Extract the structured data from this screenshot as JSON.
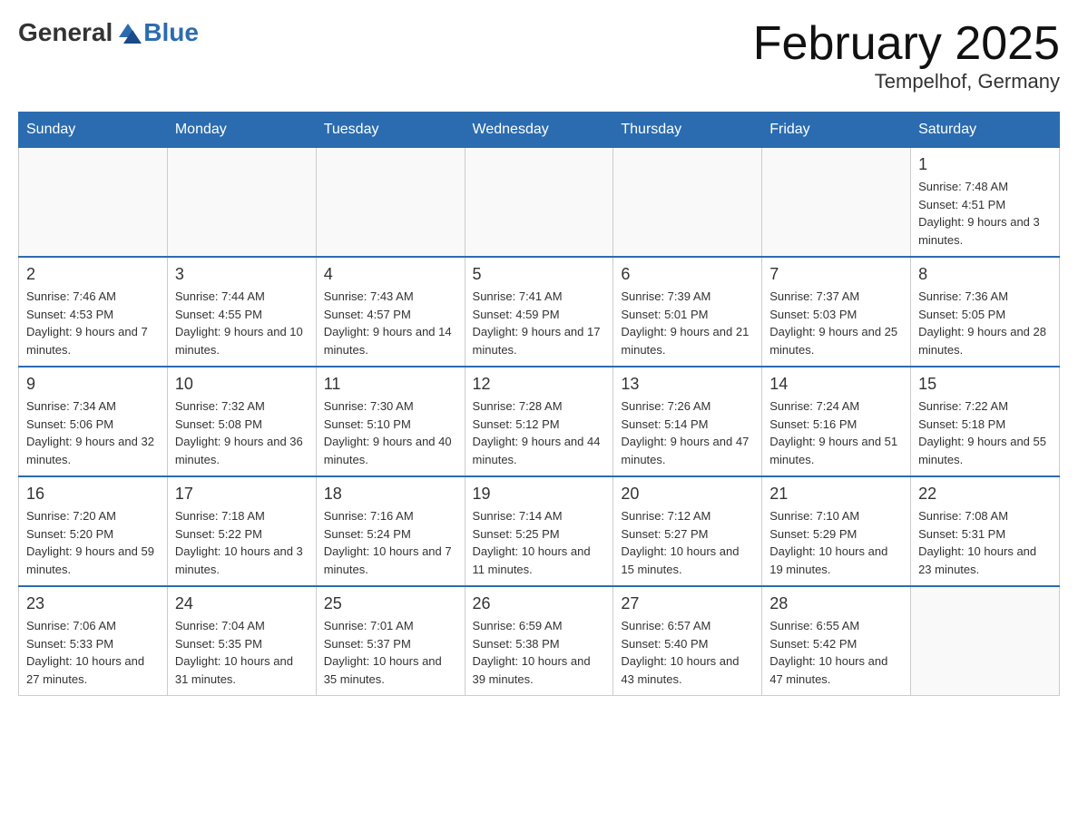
{
  "header": {
    "logo_general": "General",
    "logo_blue": "Blue",
    "title": "February 2025",
    "location": "Tempelhof, Germany"
  },
  "days_of_week": [
    "Sunday",
    "Monday",
    "Tuesday",
    "Wednesday",
    "Thursday",
    "Friday",
    "Saturday"
  ],
  "weeks": [
    [
      {
        "day": "",
        "info": ""
      },
      {
        "day": "",
        "info": ""
      },
      {
        "day": "",
        "info": ""
      },
      {
        "day": "",
        "info": ""
      },
      {
        "day": "",
        "info": ""
      },
      {
        "day": "",
        "info": ""
      },
      {
        "day": "1",
        "info": "Sunrise: 7:48 AM\nSunset: 4:51 PM\nDaylight: 9 hours and 3 minutes."
      }
    ],
    [
      {
        "day": "2",
        "info": "Sunrise: 7:46 AM\nSunset: 4:53 PM\nDaylight: 9 hours and 7 minutes."
      },
      {
        "day": "3",
        "info": "Sunrise: 7:44 AM\nSunset: 4:55 PM\nDaylight: 9 hours and 10 minutes."
      },
      {
        "day": "4",
        "info": "Sunrise: 7:43 AM\nSunset: 4:57 PM\nDaylight: 9 hours and 14 minutes."
      },
      {
        "day": "5",
        "info": "Sunrise: 7:41 AM\nSunset: 4:59 PM\nDaylight: 9 hours and 17 minutes."
      },
      {
        "day": "6",
        "info": "Sunrise: 7:39 AM\nSunset: 5:01 PM\nDaylight: 9 hours and 21 minutes."
      },
      {
        "day": "7",
        "info": "Sunrise: 7:37 AM\nSunset: 5:03 PM\nDaylight: 9 hours and 25 minutes."
      },
      {
        "day": "8",
        "info": "Sunrise: 7:36 AM\nSunset: 5:05 PM\nDaylight: 9 hours and 28 minutes."
      }
    ],
    [
      {
        "day": "9",
        "info": "Sunrise: 7:34 AM\nSunset: 5:06 PM\nDaylight: 9 hours and 32 minutes."
      },
      {
        "day": "10",
        "info": "Sunrise: 7:32 AM\nSunset: 5:08 PM\nDaylight: 9 hours and 36 minutes."
      },
      {
        "day": "11",
        "info": "Sunrise: 7:30 AM\nSunset: 5:10 PM\nDaylight: 9 hours and 40 minutes."
      },
      {
        "day": "12",
        "info": "Sunrise: 7:28 AM\nSunset: 5:12 PM\nDaylight: 9 hours and 44 minutes."
      },
      {
        "day": "13",
        "info": "Sunrise: 7:26 AM\nSunset: 5:14 PM\nDaylight: 9 hours and 47 minutes."
      },
      {
        "day": "14",
        "info": "Sunrise: 7:24 AM\nSunset: 5:16 PM\nDaylight: 9 hours and 51 minutes."
      },
      {
        "day": "15",
        "info": "Sunrise: 7:22 AM\nSunset: 5:18 PM\nDaylight: 9 hours and 55 minutes."
      }
    ],
    [
      {
        "day": "16",
        "info": "Sunrise: 7:20 AM\nSunset: 5:20 PM\nDaylight: 9 hours and 59 minutes."
      },
      {
        "day": "17",
        "info": "Sunrise: 7:18 AM\nSunset: 5:22 PM\nDaylight: 10 hours and 3 minutes."
      },
      {
        "day": "18",
        "info": "Sunrise: 7:16 AM\nSunset: 5:24 PM\nDaylight: 10 hours and 7 minutes."
      },
      {
        "day": "19",
        "info": "Sunrise: 7:14 AM\nSunset: 5:25 PM\nDaylight: 10 hours and 11 minutes."
      },
      {
        "day": "20",
        "info": "Sunrise: 7:12 AM\nSunset: 5:27 PM\nDaylight: 10 hours and 15 minutes."
      },
      {
        "day": "21",
        "info": "Sunrise: 7:10 AM\nSunset: 5:29 PM\nDaylight: 10 hours and 19 minutes."
      },
      {
        "day": "22",
        "info": "Sunrise: 7:08 AM\nSunset: 5:31 PM\nDaylight: 10 hours and 23 minutes."
      }
    ],
    [
      {
        "day": "23",
        "info": "Sunrise: 7:06 AM\nSunset: 5:33 PM\nDaylight: 10 hours and 27 minutes."
      },
      {
        "day": "24",
        "info": "Sunrise: 7:04 AM\nSunset: 5:35 PM\nDaylight: 10 hours and 31 minutes."
      },
      {
        "day": "25",
        "info": "Sunrise: 7:01 AM\nSunset: 5:37 PM\nDaylight: 10 hours and 35 minutes."
      },
      {
        "day": "26",
        "info": "Sunrise: 6:59 AM\nSunset: 5:38 PM\nDaylight: 10 hours and 39 minutes."
      },
      {
        "day": "27",
        "info": "Sunrise: 6:57 AM\nSunset: 5:40 PM\nDaylight: 10 hours and 43 minutes."
      },
      {
        "day": "28",
        "info": "Sunrise: 6:55 AM\nSunset: 5:42 PM\nDaylight: 10 hours and 47 minutes."
      },
      {
        "day": "",
        "info": ""
      }
    ]
  ]
}
